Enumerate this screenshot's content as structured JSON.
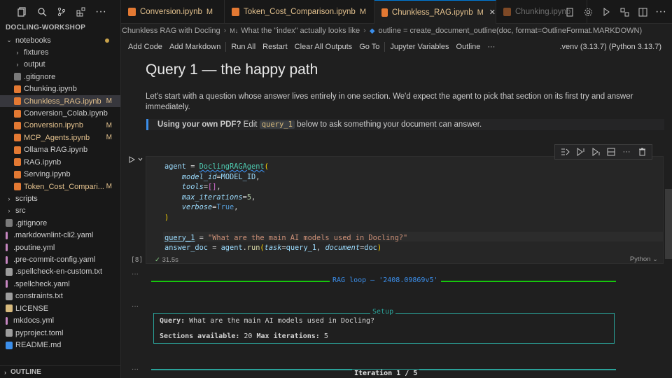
{
  "explorer": {
    "title": "DOCLING-WORKSHOP",
    "items": [
      {
        "label": "notebooks",
        "kind": "folder-open",
        "indent": 0
      },
      {
        "label": "fixtures",
        "kind": "folder",
        "indent": 1
      },
      {
        "label": "output",
        "kind": "folder",
        "indent": 1
      },
      {
        "label": ".gitignore",
        "kind": "git",
        "indent": 1
      },
      {
        "label": "Chunking.ipynb",
        "kind": "nb",
        "indent": 1
      },
      {
        "label": "Chunkless_RAG.ipynb",
        "kind": "nb",
        "indent": 1,
        "badge": "M",
        "selected": true
      },
      {
        "label": "Conversion_Colab.ipynb",
        "kind": "nb",
        "indent": 1
      },
      {
        "label": "Conversion.ipynb",
        "kind": "nb",
        "indent": 1,
        "badge": "M"
      },
      {
        "label": "MCP_Agents.ipynb",
        "kind": "nb",
        "indent": 1,
        "badge": "M"
      },
      {
        "label": "Ollama RAG.ipynb",
        "kind": "nb",
        "indent": 1
      },
      {
        "label": "RAG.ipynb",
        "kind": "nb",
        "indent": 1
      },
      {
        "label": "Serving.ipynb",
        "kind": "nb",
        "indent": 1
      },
      {
        "label": "Token_Cost_Compari...",
        "kind": "nb",
        "indent": 1,
        "badge": "M"
      },
      {
        "label": "scripts",
        "kind": "folder",
        "indent": 0
      },
      {
        "label": "src",
        "kind": "folder",
        "indent": 0
      },
      {
        "label": ".gitignore",
        "kind": "git",
        "indent": 0
      },
      {
        "label": ".markdownlint-cli2.yaml",
        "kind": "yaml",
        "indent": 0
      },
      {
        "label": ".poutine.yml",
        "kind": "yaml",
        "indent": 0
      },
      {
        "label": ".pre-commit-config.yaml",
        "kind": "yaml",
        "indent": 0
      },
      {
        "label": ".spellcheck-en-custom.txt",
        "kind": "txt",
        "indent": 0
      },
      {
        "label": ".spellcheck.yaml",
        "kind": "yaml",
        "indent": 0
      },
      {
        "label": "constraints.txt",
        "kind": "txt",
        "indent": 0
      },
      {
        "label": "LICENSE",
        "kind": "license",
        "indent": 0
      },
      {
        "label": "mkdocs.yml",
        "kind": "yaml",
        "indent": 0
      },
      {
        "label": "pyproject.toml",
        "kind": "toml",
        "indent": 0
      },
      {
        "label": "README.md",
        "kind": "md",
        "indent": 0
      }
    ],
    "outline_label": "OUTLINE"
  },
  "tabs": [
    {
      "label": "Conversion.ipynb",
      "badge": "M"
    },
    {
      "label": "Token_Cost_Comparison.ipynb",
      "badge": "M"
    },
    {
      "label": "Chunkless_RAG.ipynb",
      "badge": "M",
      "active": true
    },
    {
      "label": "Chunking.ipynb",
      "badge": ""
    }
  ],
  "breadcrumb": {
    "part1": "Chunkless RAG with Docling",
    "part2_prefix": "M↓",
    "part2": "What the \"index\" actually looks like",
    "part3": "outline = create_document_outline(doc, format=OutlineFormat.MARKDOWN)"
  },
  "toolbar": {
    "add_code": "Add Code",
    "add_markdown": "Add Markdown",
    "run_all": "Run All",
    "restart": "Restart",
    "clear_outputs": "Clear All Outputs",
    "go_to": "Go To",
    "jupyter_variables": "Jupyter Variables",
    "outline": "Outline",
    "more": "···",
    "kernel": ".venv (3.13.7) (Python 3.13.7)"
  },
  "notebook": {
    "heading": "Query 1 — the happy path",
    "paragraph": "Let's start with a question whose answer lives entirely in one section. We'd expect the agent to pick that section on its first try and answer immediately.",
    "quote_bold": "Using your own PDF?",
    "quote_mid": " Edit ",
    "quote_code": "query_1",
    "quote_end": " below to ask something your document can answer.",
    "cell": {
      "exec_count": "[8]",
      "duration": "31.5s",
      "language": "Python"
    },
    "output": {
      "rag_loop": "RAG loop — '2408.09869v5'",
      "setup_title": "Setup",
      "query_label": "Query:",
      "query_text": " What are the main AI models used in Docling?",
      "sections_label": "Sections available:",
      "sections_value": " 20",
      "iter_label": "Max iterations:",
      "iter_value": " 5",
      "iteration": "Iteration 1 / 5",
      "dots": "···"
    }
  }
}
